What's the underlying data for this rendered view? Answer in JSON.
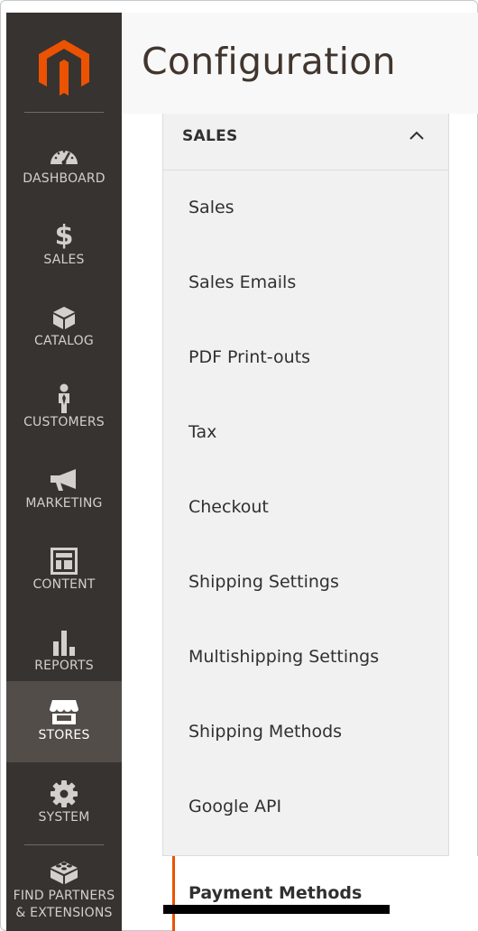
{
  "page": {
    "title": "Configuration"
  },
  "sidebar": {
    "logo_icon": "magento-logo-icon",
    "items": [
      {
        "label": "DASHBOARD",
        "icon": "dashboard-gauge-icon"
      },
      {
        "label": "SALES",
        "icon": "dollar-icon"
      },
      {
        "label": "CATALOG",
        "icon": "box-icon"
      },
      {
        "label": "CUSTOMERS",
        "icon": "person-icon"
      },
      {
        "label": "MARKETING",
        "icon": "megaphone-icon"
      },
      {
        "label": "CONTENT",
        "icon": "layout-icon"
      },
      {
        "label": "REPORTS",
        "icon": "bar-chart-icon"
      },
      {
        "label": "STORES",
        "icon": "storefront-icon"
      },
      {
        "label": "SYSTEM",
        "icon": "gear-icon"
      },
      {
        "label_line1": "FIND PARTNERS",
        "label_line2": "& EXTENSIONS",
        "icon": "brick-icon"
      }
    ],
    "active": "STORES"
  },
  "config_panel": {
    "group_label": "SALES",
    "expanded": true,
    "sections": [
      {
        "label": "Sales"
      },
      {
        "label": "Sales Emails"
      },
      {
        "label": "PDF Print-outs"
      },
      {
        "label": "Tax"
      },
      {
        "label": "Checkout"
      },
      {
        "label": "Shipping Settings"
      },
      {
        "label": "Multishipping Settings"
      },
      {
        "label": "Shipping Methods"
      },
      {
        "label": "Google API"
      }
    ],
    "active_section": "Payment Methods"
  },
  "colors": {
    "sidebar_bg": "#373330",
    "sidebar_active_bg": "#524d49",
    "logo_orange": "#eb5202",
    "panel_bg": "#f1f1f1",
    "header_bg": "#f8f8f8",
    "active_bar": "#eb5202"
  }
}
